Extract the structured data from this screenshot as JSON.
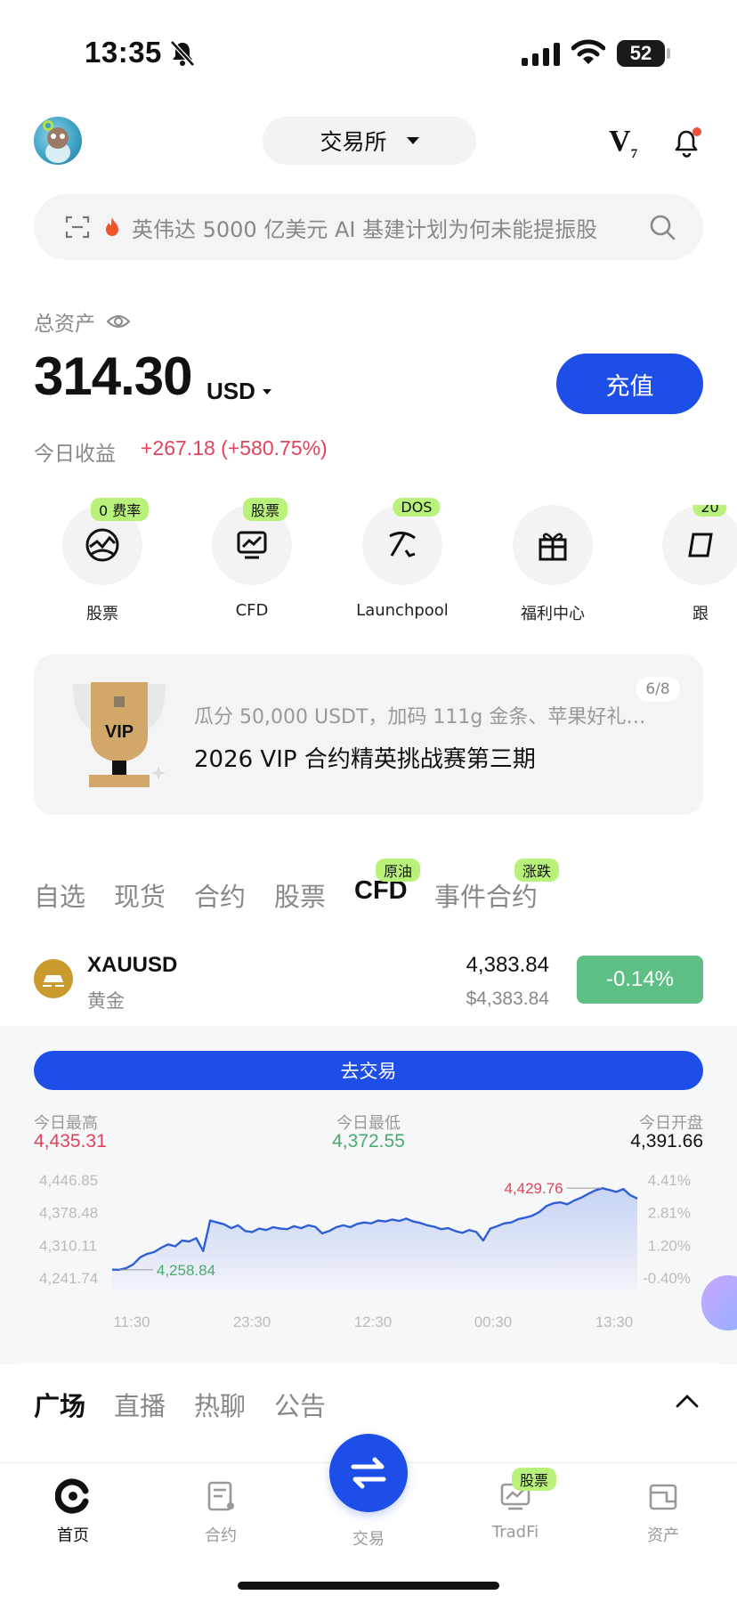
{
  "status_bar": {
    "time": "13:35",
    "battery": "52"
  },
  "header": {
    "exchange_label": "交易所",
    "vip_level": "V",
    "vip_sub": "7"
  },
  "search": {
    "text": "英伟达 5000 亿美元 AI 基建计划为何未能提振股"
  },
  "assets": {
    "total_label": "总资产",
    "balance": "314.30",
    "currency": "USD",
    "deposit_label": "充值",
    "pnl_label": "今日收益",
    "pnl_value": "+267.18 (+580.75%)"
  },
  "quick_actions": [
    {
      "label": "股票",
      "tag": "0 费率",
      "icon": "stock-globe-icon"
    },
    {
      "label": "CFD",
      "tag": "股票",
      "icon": "chart-screen-icon"
    },
    {
      "label": "Launchpool",
      "tag": "DOS",
      "icon": "pickaxe-icon"
    },
    {
      "label": "福利中心",
      "tag": "",
      "icon": "gift-icon"
    },
    {
      "label": "跟",
      "tag": "20",
      "icon": "copy-trade-icon"
    }
  ],
  "banner": {
    "subtitle": "瓜分 50,000 USDT，加码 111g 金条、苹果好礼…",
    "title": "2026 VIP 合约精英挑战赛第三期",
    "page": "6/8",
    "trophy_text": "VIP"
  },
  "market_tabs": [
    {
      "label": "自选",
      "tag": ""
    },
    {
      "label": "现货",
      "tag": ""
    },
    {
      "label": "合约",
      "tag": ""
    },
    {
      "label": "股票",
      "tag": ""
    },
    {
      "label": "CFD",
      "tag": "原油"
    },
    {
      "label": "事件合约",
      "tag": "涨跌"
    }
  ],
  "market_row": {
    "symbol": "XAUUSD",
    "name": "黄金",
    "price": "4,383.84",
    "price_usd": "$4,383.84",
    "change": "-0.14%"
  },
  "detail": {
    "trade_label": "去交易",
    "high_label": "今日最高",
    "high_value": "4,435.31",
    "low_label": "今日最低",
    "low_value": "4,372.55",
    "open_label": "今日开盘",
    "open_value": "4,391.66"
  },
  "chart_data": {
    "type": "area",
    "x_ticks": [
      "11:30",
      "23:30",
      "12:30",
      "00:30",
      "13:30"
    ],
    "y_ticks_left": [
      "4,446.85",
      "4,378.48",
      "4,310.11",
      "4,241.74"
    ],
    "y_ticks_right": [
      "4.41%",
      "2.81%",
      "1.20%",
      "-0.40%"
    ],
    "ylim": [
      4241.74,
      4446.85
    ],
    "max_label": "4,429.76",
    "min_label": "4,258.84",
    "values": [
      4259,
      4258.84,
      4262,
      4270,
      4285,
      4292,
      4296,
      4305,
      4312,
      4308,
      4320,
      4318,
      4325,
      4298,
      4362,
      4358,
      4354,
      4346,
      4352,
      4340,
      4338,
      4345,
      4342,
      4348,
      4345,
      4344,
      4350,
      4346,
      4352,
      4349,
      4335,
      4340,
      4348,
      4352,
      4348,
      4355,
      4358,
      4356,
      4362,
      4360,
      4364,
      4361,
      4366,
      4360,
      4357,
      4352,
      4349,
      4344,
      4346,
      4340,
      4336,
      4342,
      4338,
      4320,
      4345,
      4350,
      4356,
      4358,
      4365,
      4368,
      4372,
      4380,
      4392,
      4398,
      4400,
      4396,
      4404,
      4410,
      4418,
      4425,
      4429.76,
      4426,
      4422,
      4428,
      4415,
      4408
    ],
    "line_color": "#2f5fd8",
    "high_color": "#e0445a",
    "low_color": "#4aaa6e"
  },
  "feed_tabs": [
    "广场",
    "直播",
    "热聊",
    "公告"
  ],
  "nav": [
    {
      "label": "首页",
      "icon": "home-logo-icon"
    },
    {
      "label": "合约",
      "icon": "contract-doc-icon"
    },
    {
      "label": "交易",
      "icon": "swap-arrows-icon"
    },
    {
      "label": "TradFi",
      "icon": "tradfi-chart-icon"
    },
    {
      "label": "资产",
      "icon": "wallet-icon"
    }
  ],
  "nav_tradfi_tag": "股票",
  "colors": {
    "accent": "#1d4fe8",
    "up": "#e0445a",
    "down": "#5dbf84",
    "tag": "#b8f27a"
  }
}
